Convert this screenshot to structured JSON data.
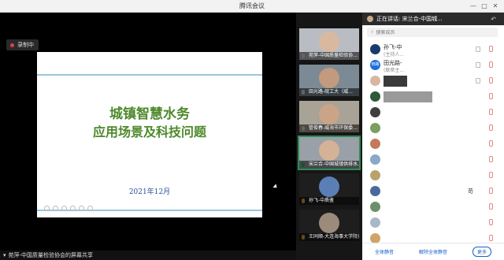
{
  "window": {
    "title": "腾讯会议",
    "controls": [
      "—",
      "□",
      "✕"
    ]
  },
  "recording": {
    "label": "录制中"
  },
  "slide": {
    "title_line1": "城镇智慧水务",
    "title_line2": "应用场景及科技问题",
    "date": "2021年12月"
  },
  "screen_share": {
    "label": "苑萍-中国质量检验协会的屏幕共享"
  },
  "tiles": [
    {
      "label": "苑萍-中国质量检验协..."
    },
    {
      "label": "田光路-皖工大（威..."
    },
    {
      "label": "管俊春-威海市环保委..."
    },
    {
      "label": "宋兰合-中国城镇供排水..."
    },
    {
      "label": "孙飞-中质鉴"
    },
    {
      "label": "王同顺-大连海事大学院长"
    }
  ],
  "panel": {
    "speaking": "正在讲话: 宋兰合-中国城...",
    "search_placeholder": "搜索成员",
    "members": [
      {
        "name": "孙飞-中",
        "sub": "(主持人..."
      },
      {
        "name": "田光路-",
        "sub": "(联席主...",
        "avatar_text": "田路"
      },
      {
        "name": "",
        "sub": ""
      },
      {
        "name": "",
        "sub": ""
      },
      {
        "name": "",
        "sub": ""
      },
      {
        "name": "",
        "sub": ""
      },
      {
        "name": "",
        "sub": ""
      },
      {
        "name": "",
        "sub": ""
      },
      {
        "name": "",
        "sub": ""
      },
      {
        "name": "",
        "sub": "",
        "extra": "苛"
      },
      {
        "name": "",
        "sub": ""
      },
      {
        "name": "",
        "sub": ""
      },
      {
        "name": "",
        "sub": ""
      },
      {
        "name": "",
        "sub": ""
      }
    ],
    "footer": {
      "mute_all": "全体静音",
      "unmute_all": "解除全体静音",
      "more": "更多"
    }
  },
  "colors": {
    "accent": "#4e8a2c",
    "link": "#1a5fcc",
    "record": "#e04343"
  }
}
